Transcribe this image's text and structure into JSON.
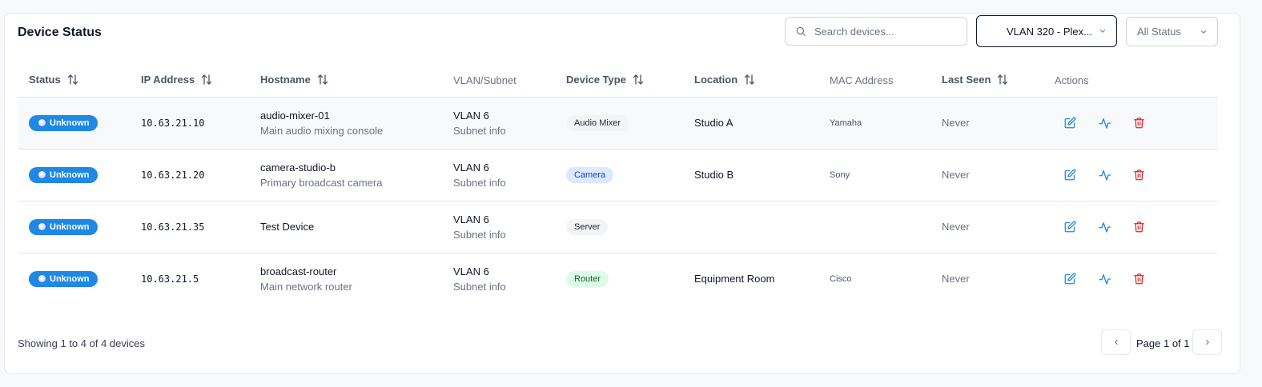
{
  "header": {
    "title": "Device Status",
    "search_placeholder": "Search devices...",
    "vlan_filter": "VLAN 320 - Plex...",
    "status_filter": "All Status"
  },
  "columns": [
    "Status",
    "IP Address",
    "Hostname",
    "VLAN/Subnet",
    "Device Type",
    "Location",
    "MAC Address",
    "Last Seen",
    "Actions"
  ],
  "rows": [
    {
      "status": "Unknown",
      "ip": "10.63.21.10",
      "hostname": "audio-mixer-01",
      "description": "Main audio mixing console",
      "vlan": "VLAN 6",
      "subnet": "Subnet info",
      "type": "Audio Mixer",
      "location": "Studio A",
      "mac": "Yamaha",
      "last_seen": "Never"
    },
    {
      "status": "Unknown",
      "ip": "10.63.21.20",
      "hostname": "camera-studio-b",
      "description": "Primary broadcast camera",
      "vlan": "VLAN 6",
      "subnet": "Subnet info",
      "type": "Camera",
      "location": "Studio B",
      "mac": "Sony",
      "last_seen": "Never"
    },
    {
      "status": "Unknown",
      "ip": "10.63.21.35",
      "hostname": "Test Device",
      "description": "",
      "vlan": "VLAN 6",
      "subnet": "Subnet info",
      "type": "Server",
      "location": "",
      "mac": "",
      "last_seen": "Never"
    },
    {
      "status": "Unknown",
      "ip": "10.63.21.5",
      "hostname": "broadcast-router",
      "description": "Main network router",
      "vlan": "VLAN 6",
      "subnet": "Subnet info",
      "type": "Router",
      "location": "Equipment Room",
      "mac": "Cisco",
      "last_seen": "Never"
    }
  ],
  "type_colors": {
    "Audio Mixer": {
      "bg": "#f3f4f6",
      "fg": "#1f2937"
    },
    "Camera": {
      "bg": "#dbeafe",
      "fg": "#1e40af"
    },
    "Server": {
      "bg": "#f3f4f6",
      "fg": "#1f2937"
    },
    "Router": {
      "bg": "#dcfce7",
      "fg": "#166534"
    }
  },
  "colors": {
    "status_badge": "#1e88e5",
    "edit_icon": "#1e88e5",
    "activity_icon": "#1e88e5",
    "delete_icon": "#dc2626"
  },
  "icons": {
    "search": "search-icon",
    "dropdown": "chevron-down-icon",
    "sort": "sort-arrows-icon",
    "edit": "edit-icon",
    "activity": "activity-icon",
    "delete": "trash-icon",
    "prev": "chevron-left-icon",
    "next": "chevron-right-icon"
  },
  "footer": {
    "showing": "Showing 1 to 4 of 4 devices",
    "page_label": "Page 1 of 1"
  }
}
